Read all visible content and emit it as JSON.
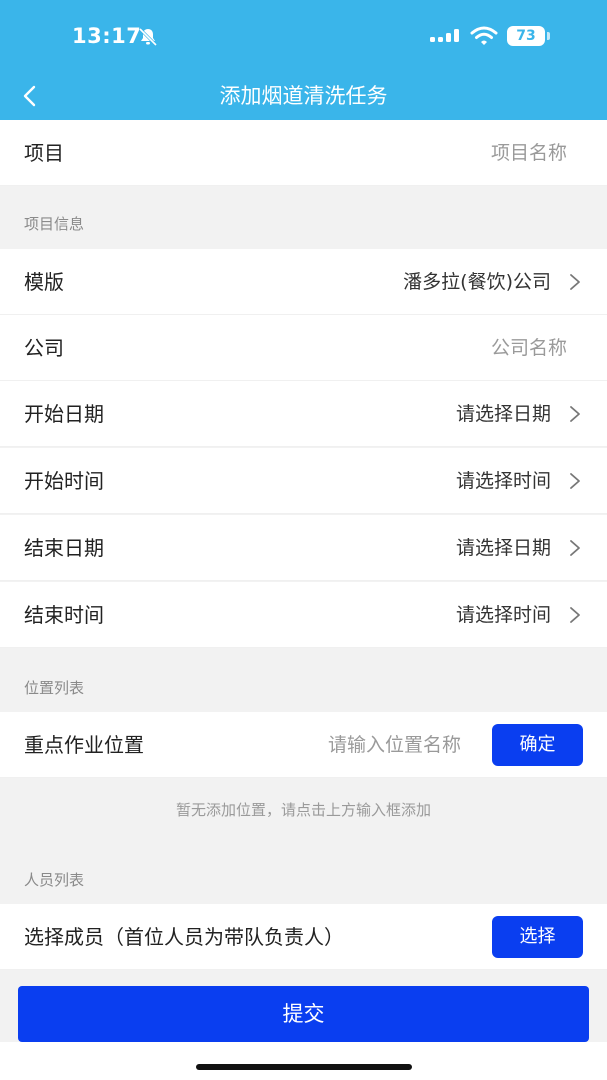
{
  "status_bar": {
    "time": "13:17",
    "battery": "73"
  },
  "nav": {
    "title": "添加烟道清洗任务"
  },
  "project": {
    "label": "项目",
    "placeholder": "项目名称"
  },
  "sections": {
    "project_info": "项目信息",
    "location_list": "位置列表",
    "member_list": "人员列表"
  },
  "fields": {
    "template": {
      "label": "模版",
      "value": "潘多拉(餐饮)公司"
    },
    "company": {
      "label": "公司",
      "placeholder": "公司名称"
    },
    "start_date": {
      "label": "开始日期",
      "value": "请选择日期"
    },
    "start_time": {
      "label": "开始时间",
      "value": "请选择时间"
    },
    "end_date": {
      "label": "结束日期",
      "value": "请选择日期"
    },
    "end_time": {
      "label": "结束时间",
      "value": "请选择时间"
    }
  },
  "location": {
    "label": "重点作业位置",
    "placeholder": "请输入位置名称",
    "confirm_label": "确定",
    "empty_hint": "暂无添加位置，请点击上方输入框添加"
  },
  "members": {
    "label": "选择成员（首位人员为带队负责人）",
    "select_label": "选择"
  },
  "submit_label": "提交",
  "colors": {
    "header": "#3ab5ea",
    "primary_button": "#0a3ef0",
    "background": "#f2f2f2"
  }
}
